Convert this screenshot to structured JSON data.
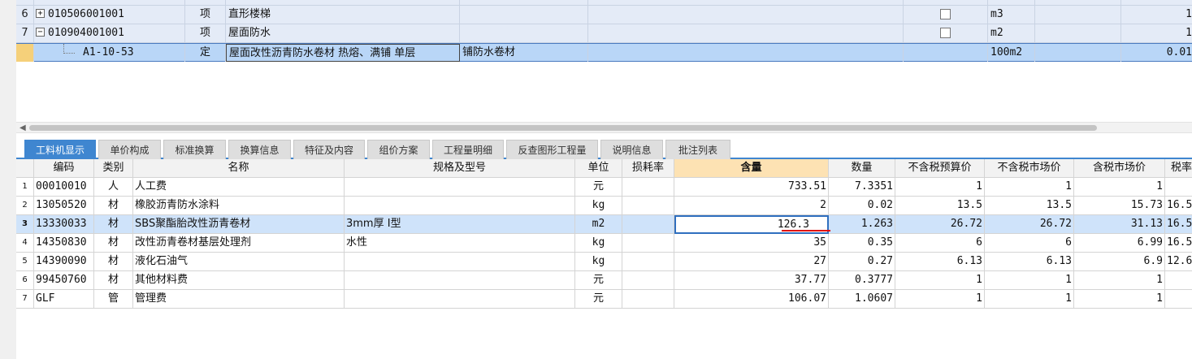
{
  "upper_grid": {
    "rows": [
      {
        "num": "6",
        "expander": "+",
        "code": "010506001001",
        "type": "项",
        "name": "直形楼梯",
        "unit": "m3",
        "qty": "1"
      },
      {
        "num": "7",
        "expander": "−",
        "code": "010904001001",
        "type": "项",
        "name": "屋面防水",
        "unit": "m2",
        "qty": "1"
      },
      {
        "num": "",
        "expander": "",
        "code": "A1-10-53",
        "type": "定",
        "name": "屋面改性沥青防水卷材 热熔、满铺 单层",
        "spec": "铺防水卷材",
        "unit": "100m2",
        "qty": "0.01"
      }
    ]
  },
  "tabs": [
    "工料机显示",
    "单价构成",
    "标准换算",
    "换算信息",
    "特征及内容",
    "组价方案",
    "工程量明细",
    "反查图形工程量",
    "说明信息",
    "批注列表"
  ],
  "active_tab": "工料机显示",
  "lower_grid": {
    "headers": {
      "code": "编码",
      "type": "类别",
      "name": "名称",
      "spec": "规格及型号",
      "unit": "单位",
      "loss": "损耗率",
      "content": "含量",
      "qty": "数量",
      "budget_price": "不含税预算价",
      "market_price": "不含税市场价",
      "tax_market_price": "含税市场价",
      "tax_rate": "税率"
    },
    "rows": [
      {
        "num": "1",
        "code": "00010010",
        "type": "人",
        "name": "人工费",
        "spec": "",
        "unit": "元",
        "content": "733.51",
        "qty": "7.3351",
        "budget": "1",
        "market": "1",
        "tax_market": "1",
        "tax_rate": ""
      },
      {
        "num": "2",
        "code": "13050520",
        "type": "材",
        "name": "橡胶沥青防水涂料",
        "spec": "",
        "unit": "kg",
        "content": "2",
        "qty": "0.02",
        "budget": "13.5",
        "market": "13.5",
        "tax_market": "15.73",
        "tax_rate": "16.5"
      },
      {
        "num": "3",
        "code": "13330033",
        "type": "材",
        "name": "SBS聚酯胎改性沥青卷材",
        "spec": "3mm厚 I型",
        "unit": "m2",
        "content": "126.3",
        "qty": "1.263",
        "budget": "26.72",
        "market": "26.72",
        "tax_market": "31.13",
        "tax_rate": "16.5"
      },
      {
        "num": "4",
        "code": "14350830",
        "type": "材",
        "name": "改性沥青卷材基层处理剂",
        "spec": "水性",
        "unit": "kg",
        "content": "35",
        "qty": "0.35",
        "budget": "6",
        "market": "6",
        "tax_market": "6.99",
        "tax_rate": "16.5"
      },
      {
        "num": "5",
        "code": "14390090",
        "type": "材",
        "name": "液化石油气",
        "spec": "",
        "unit": "kg",
        "content": "27",
        "qty": "0.27",
        "budget": "6.13",
        "market": "6.13",
        "tax_market": "6.9",
        "tax_rate": "12.6"
      },
      {
        "num": "6",
        "code": "99450760",
        "type": "材",
        "name": "其他材料费",
        "spec": "",
        "unit": "元",
        "content": "37.77",
        "qty": "0.3777",
        "budget": "1",
        "market": "1",
        "tax_market": "1",
        "tax_rate": ""
      },
      {
        "num": "7",
        "code": "GLF",
        "type": "管",
        "name": "管理费",
        "spec": "",
        "unit": "元",
        "content": "106.07",
        "qty": "1.0607",
        "budget": "1",
        "market": "1",
        "tax_market": "1",
        "tax_rate": ""
      }
    ]
  },
  "colors": {
    "tab_active": "#3f86d0",
    "selected_row": "#cfe3fa",
    "header_highlight": "#fde2b3",
    "underline": "#e00000"
  }
}
